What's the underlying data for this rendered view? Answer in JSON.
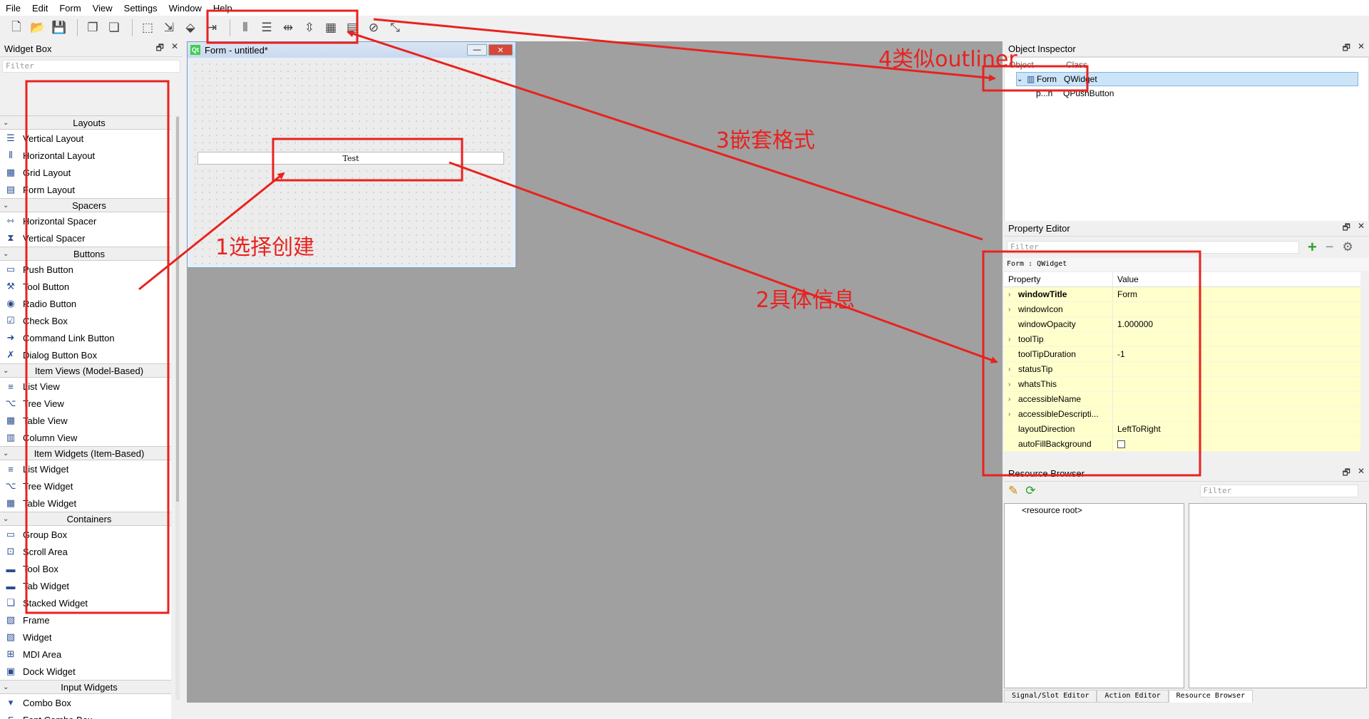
{
  "menu": [
    "File",
    "Edit",
    "Form",
    "View",
    "Settings",
    "Window",
    "Help"
  ],
  "widget_box": {
    "title": "Widget Box",
    "filter_placeholder": "Filter",
    "categories": [
      {
        "label": "Layouts",
        "items": [
          "Vertical Layout",
          "Horizontal Layout",
          "Grid Layout",
          "Form Layout"
        ]
      },
      {
        "label": "Spacers",
        "items": [
          "Horizontal Spacer",
          "Vertical Spacer"
        ]
      },
      {
        "label": "Buttons",
        "items": [
          "Push Button",
          "Tool Button",
          "Radio Button",
          "Check Box",
          "Command Link Button",
          "Dialog Button Box"
        ]
      },
      {
        "label": "Item Views (Model-Based)",
        "items": [
          "List View",
          "Tree View",
          "Table View",
          "Column View"
        ]
      },
      {
        "label": "Item Widgets (Item-Based)",
        "items": [
          "List Widget",
          "Tree Widget",
          "Table Widget"
        ]
      },
      {
        "label": "Containers",
        "items": [
          "Group Box",
          "Scroll Area",
          "Tool Box",
          "Tab Widget",
          "Stacked Widget",
          "Frame",
          "Widget",
          "MDI Area",
          "Dock Widget"
        ]
      },
      {
        "label": "Input Widgets",
        "items": [
          "Combo Box",
          "Font Combo Box",
          "Line Edit"
        ]
      }
    ]
  },
  "form_window": {
    "title": "Form - untitled*",
    "button_text": "Test"
  },
  "object_inspector": {
    "title": "Object Inspector",
    "columns": [
      "Object",
      "Class"
    ],
    "rows": [
      {
        "object": "Form",
        "class": "QWidget"
      },
      {
        "object": "p...n",
        "class": "QPushButton"
      }
    ]
  },
  "property_editor": {
    "title": "Property Editor",
    "filter_placeholder": "Filter",
    "object_label": "Form : QWidget",
    "columns": [
      "Property",
      "Value"
    ],
    "rows": [
      {
        "name": "windowTitle",
        "value": "Form",
        "bold": true
      },
      {
        "name": "windowIcon",
        "value": ""
      },
      {
        "name": "windowOpacity",
        "value": "1.000000"
      },
      {
        "name": "toolTip",
        "value": ""
      },
      {
        "name": "toolTipDuration",
        "value": "-1"
      },
      {
        "name": "statusTip",
        "value": ""
      },
      {
        "name": "whatsThis",
        "value": ""
      },
      {
        "name": "accessibleName",
        "value": ""
      },
      {
        "name": "accessibleDescripti...",
        "value": ""
      },
      {
        "name": "layoutDirection",
        "value": "LeftToRight"
      },
      {
        "name": "autoFillBackground",
        "value": ""
      }
    ]
  },
  "resource_browser": {
    "title": "Resource Browser",
    "filter_placeholder": "Filter",
    "root": "<resource root>"
  },
  "bottom_tabs": [
    "Signal/Slot Editor",
    "Action Editor",
    "Resource Browser"
  ],
  "annotations": {
    "a1": "1选择创建",
    "a2": "2具体信息",
    "a3": "3嵌套格式",
    "a4": "4类似outliner"
  },
  "colors": {
    "annotation": "#e8221f",
    "selection": "#cce4f7",
    "property_highlight": "#ffffcc"
  }
}
